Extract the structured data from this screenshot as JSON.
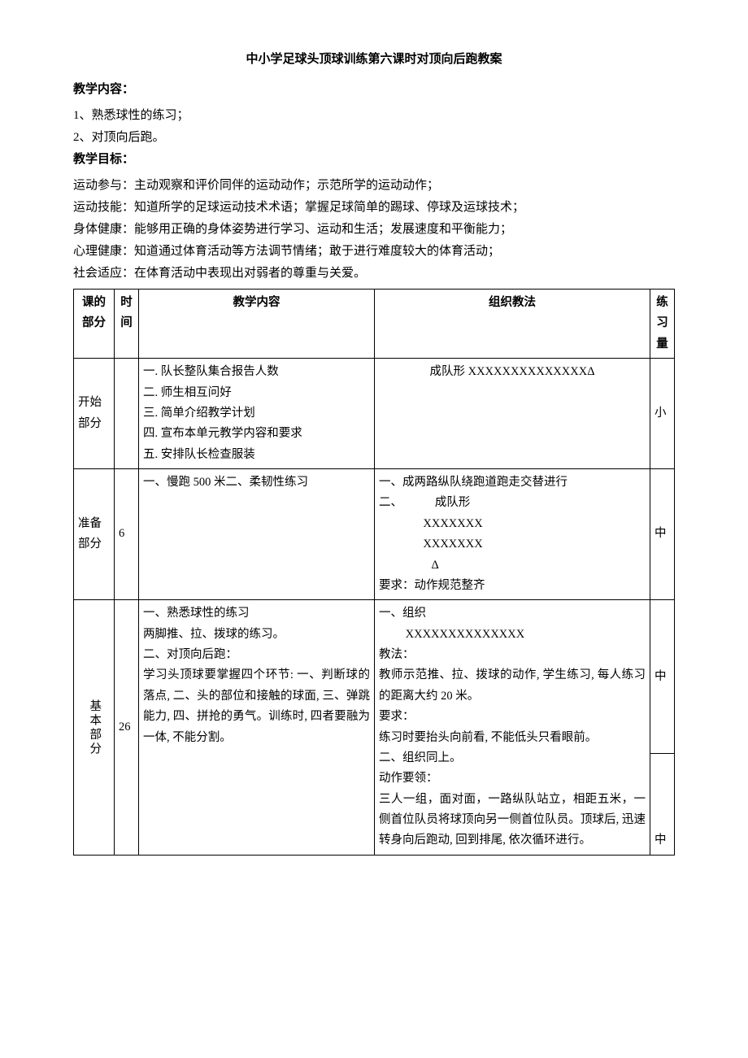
{
  "title": "中小学足球头顶球训练第六课时对顶向后跑教案",
  "content_label": "教学内容：",
  "content_items": [
    "1、熟悉球性的练习；",
    "2、对顶向后跑。"
  ],
  "goals_label": "教学目标：",
  "goals": [
    "运动参与：主动观察和评价同伴的运动动作；示范所学的运动动作；",
    "运动技能：知道所学的足球运动技术术语；掌握足球简单的踢球、停球及运球技术；",
    "身体健康：能够用正确的身体姿势进行学习、运动和生活；发展速度和平衡能力；",
    "心理健康：知道通过体育活动等方法调节情绪；敢于进行难度较大的体育活动；",
    "社会适应：在体育活动中表现出对弱者的尊重与关爱。"
  ],
  "headers": {
    "part": "课的部分",
    "time": "时间",
    "content": "教学内容",
    "method": "组织教法",
    "load": "练习量"
  },
  "rows": [
    {
      "part": "开始部分",
      "time": "",
      "content": [
        "一. 队长整队集合报告人数",
        "二. 师生相互问好",
        "三. 简单介绍教学计划",
        "四. 宣布本单元教学内容和要求",
        "五. 安排队长检查服装"
      ],
      "method": "成队形 XXXXXXXXXXXXXXΔ",
      "load": "小"
    },
    {
      "part": "准备部分",
      "time": "6",
      "content": [
        "一、慢跑 500 米二、柔韧性练习"
      ],
      "method_lines": [
        "一、成两路纵队绕跑道跑走交替进行",
        "二、           成队形",
        "               XXXXXXX",
        "               XXXXXXX",
        "                  Δ",
        "要求：动作规范整齐"
      ],
      "load": "中"
    },
    {
      "part": "基本部分",
      "time": "26",
      "content_paras": [
        "一、熟悉球性的练习",
        "两脚推、拉、拨球的练习。",
        "",
        "二、对顶向后跑：",
        "学习头顶球要掌握四个环节: 一、判断球的落点, 二、头的部位和接触的球面, 三、弹跳能力, 四、拼抢的勇气。训练时, 四者要融为一体, 不能分割。"
      ],
      "method_paras": [
        "一、组织",
        "         XXXXXXXXXXXXXX",
        "教法：",
        "    教师示范推、拉、拨球的动作, 学生练习, 每人练习的距离大约 20 米。",
        "要求：",
        "    练习时要抬头向前看, 不能低头只看眼前。",
        "二、组织同上。",
        "  动作要领：",
        "三人一组，面对面，一路纵队站立，相距五米，一侧首位队员将球顶向另一侧首位队员。顶球后, 迅速转身向后跑动, 回到排尾, 依次循环进行。"
      ],
      "load": "中",
      "load2": "中"
    }
  ]
}
